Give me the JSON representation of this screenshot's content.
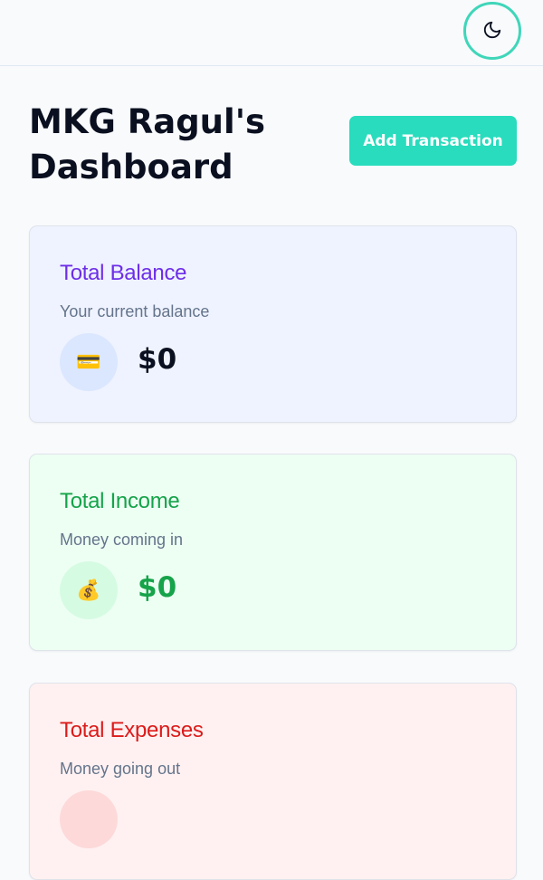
{
  "header": {
    "theme_toggle_icon": "moon-icon",
    "accent_color": "#3fd6b9"
  },
  "page": {
    "title": "MKG Ragul's Dashboard",
    "add_transaction_label": "Add Transaction"
  },
  "cards": {
    "balance": {
      "title": "Total Balance",
      "subtitle": "Your current balance",
      "amount": "$0",
      "icon": "credit-card-icon",
      "icon_glyph": "💳",
      "color": "#6d2ee8"
    },
    "income": {
      "title": "Total Income",
      "subtitle": "Money coming in",
      "amount": "$0",
      "icon": "money-bag-icon",
      "icon_glyph": "💰",
      "color": "#16a34a"
    },
    "expenses": {
      "title": "Total Expenses",
      "subtitle": "Money going out",
      "color": "#dc1b1b"
    }
  }
}
